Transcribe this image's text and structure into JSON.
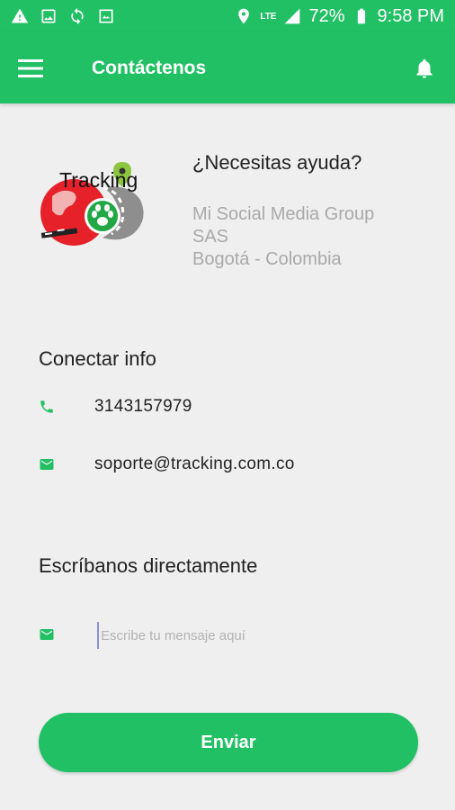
{
  "status_bar": {
    "network": "LTE",
    "battery": "72%",
    "time": "9:58 PM",
    "icons": [
      "warning-icon",
      "image-icon",
      "sync-icon",
      "gallery-icon",
      "location-icon",
      "signal-icon",
      "battery-icon"
    ]
  },
  "app_bar": {
    "title": "Contáctenos",
    "color": "#21c064"
  },
  "header": {
    "logo_text": "Tracking",
    "help_title": "¿Necesitas ayuda?",
    "company_lines": [
      "Mi Social Media Group",
      "SAS",
      "Bogotá - Colombia"
    ]
  },
  "contact_info": {
    "title": "Conectar info",
    "phone": "3143157979",
    "email": "soporte@tracking.com.co"
  },
  "message": {
    "title": "Escríbanos directamente",
    "placeholder": "Escribe tu mensaje aquí",
    "value": ""
  },
  "send_button": {
    "label": "Enviar"
  }
}
